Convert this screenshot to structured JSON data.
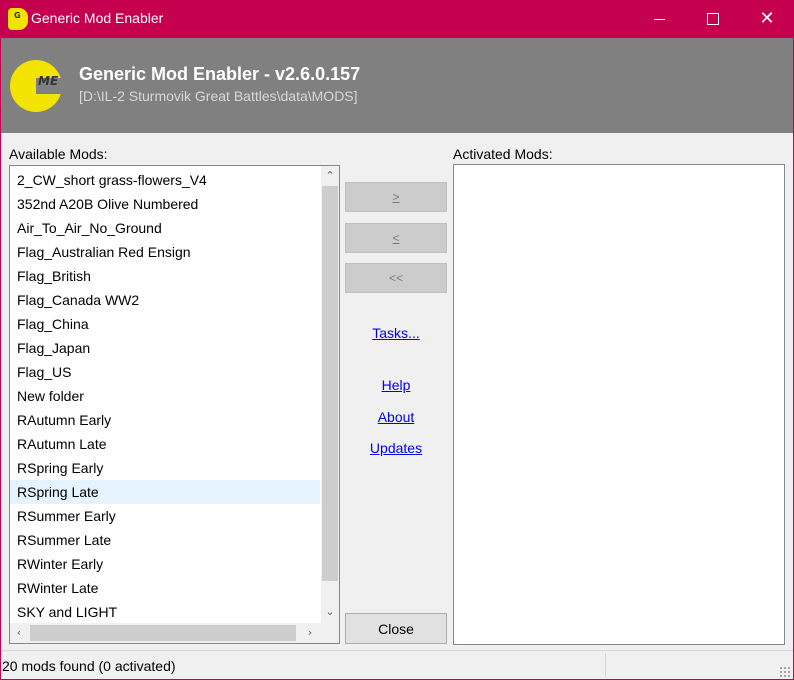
{
  "window": {
    "title": "Generic Mod Enabler",
    "icon": "gme-app-icon",
    "controls": [
      "minimize",
      "maximize",
      "close"
    ]
  },
  "header": {
    "logo_letters": "ME",
    "title": "Generic Mod Enabler - v2.6.0.157",
    "path": "[D:\\IL-2 Sturmovik Great Battles\\data\\MODS]"
  },
  "available": {
    "label": "Available Mods:",
    "items": [
      "2_CW_short grass-flowers_V4",
      "352nd A20B Olive Numbered",
      "Air_To_Air_No_Ground",
      "Flag_Australian Red Ensign",
      "Flag_British",
      "Flag_Canada WW2",
      "Flag_China",
      "Flag_Japan",
      "Flag_US",
      "New folder",
      "RAutumn Early",
      "RAutumn Late",
      "RSpring Early",
      "RSpring Late",
      "RSummer Early",
      "RSummer Late",
      "RWinter Early",
      "RWinter Late",
      "SKY and LIGHT"
    ],
    "hovered_item": "RSpring Late"
  },
  "activated": {
    "label": "Activated Mods:",
    "items": []
  },
  "buttons": {
    "activate": ">",
    "deactivate": "<",
    "deactivate_all": "<<",
    "close": "Close"
  },
  "links": {
    "tasks": "Tasks...",
    "help": "Help",
    "about": "About",
    "updates": "Updates"
  },
  "status": {
    "text": "20 mods found (0 activated)"
  },
  "colors": {
    "titlebar": "#c4004f",
    "header_band": "#808080",
    "logo": "#f2e400",
    "link": "#0000ee",
    "hover_row": "#e5f3ff"
  }
}
